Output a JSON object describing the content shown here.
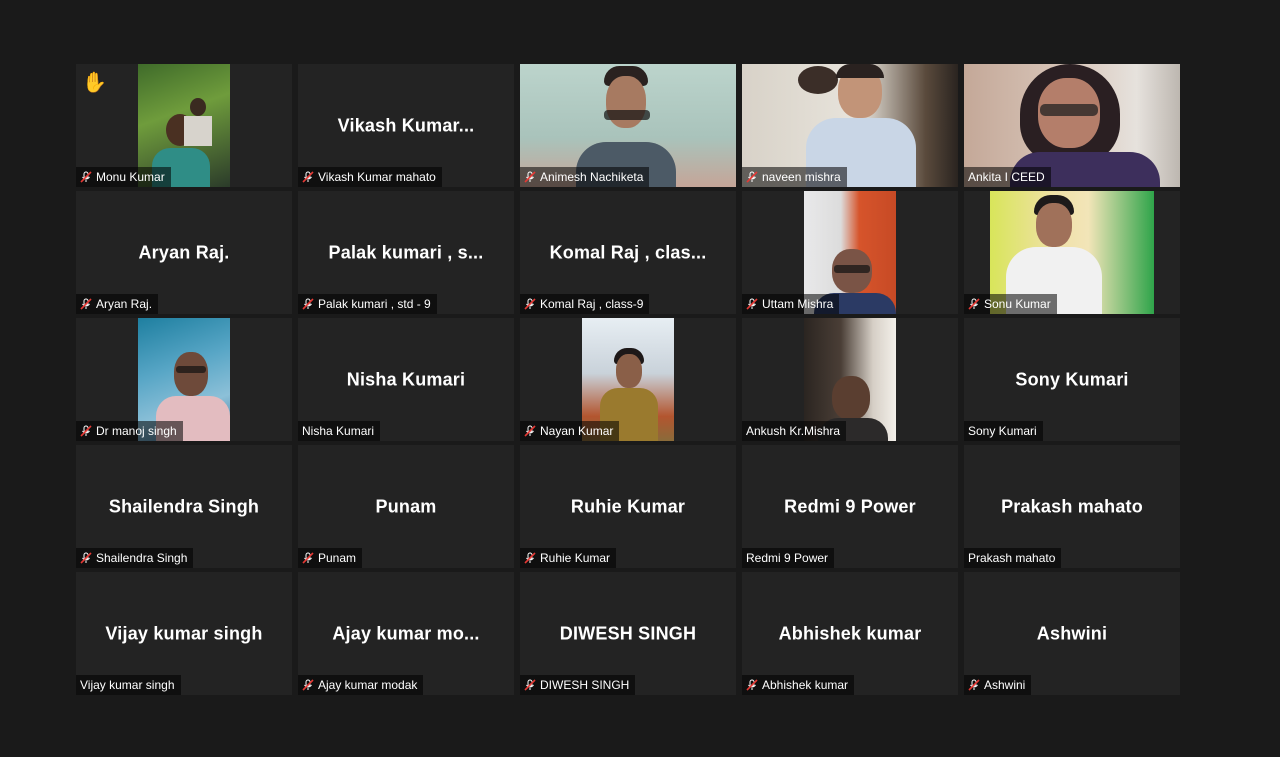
{
  "participants": [
    {
      "label": "Monu Kumar",
      "muted": true,
      "video": true,
      "hand": true
    },
    {
      "label": "Vikash Kumar mahato",
      "display": "Vikash  Kumar...",
      "muted": true,
      "video": false
    },
    {
      "label": "Animesh Nachiketa",
      "muted": true,
      "video": true
    },
    {
      "label": "naveen mishra",
      "muted": true,
      "video": true
    },
    {
      "label": "Ankita I CEED",
      "muted": false,
      "video": true,
      "active": true
    },
    {
      "label": "Aryan Raj.",
      "display": "Aryan Raj.",
      "muted": true,
      "video": false
    },
    {
      "label": "Palak kumari , std - 9",
      "display": "Palak kumari , s...",
      "muted": true,
      "video": false
    },
    {
      "label": "Komal Raj , class-9",
      "display": "Komal Raj , clas...",
      "muted": true,
      "video": false
    },
    {
      "label": "Uttam Mishra",
      "muted": true,
      "video": true
    },
    {
      "label": "Sonu Kumar",
      "muted": true,
      "video": true
    },
    {
      "label": "Dr manoj singh",
      "muted": true,
      "video": true
    },
    {
      "label": "Nisha Kumari",
      "display": "Nisha Kumari",
      "muted": false,
      "video": false
    },
    {
      "label": "Nayan Kumar",
      "muted": true,
      "video": true
    },
    {
      "label": "Ankush Kr.Mishra",
      "muted": false,
      "video": true
    },
    {
      "label": "Sony Kumari",
      "display": "Sony Kumari",
      "muted": false,
      "video": false
    },
    {
      "label": "Shailendra Singh",
      "display": "Shailendra Singh",
      "muted": true,
      "video": false
    },
    {
      "label": "Punam",
      "display": "Punam",
      "muted": true,
      "video": false
    },
    {
      "label": "Ruhie Kumar",
      "display": "Ruhie Kumar",
      "muted": true,
      "video": false
    },
    {
      "label": "Redmi 9 Power",
      "display": "Redmi 9 Power",
      "muted": false,
      "video": false
    },
    {
      "label": "Prakash mahato",
      "display": "Prakash mahato",
      "muted": false,
      "video": false
    },
    {
      "label": "Vijay kumar singh",
      "display": "Vijay kumar singh",
      "muted": false,
      "video": false
    },
    {
      "label": "Ajay kumar modak",
      "display": "Ajay  kumar  mo...",
      "muted": true,
      "video": false
    },
    {
      "label": "DIWESH SINGH",
      "display": "DIWESH SINGH",
      "muted": true,
      "video": false
    },
    {
      "label": "Abhishek kumar",
      "display": "Abhishek kumar",
      "muted": true,
      "video": false
    },
    {
      "label": "Ashwini",
      "display": "Ashwini",
      "muted": true,
      "video": false
    }
  ],
  "colors": {
    "background": "#1a1a1a",
    "tile": "#232323",
    "active_outline": "#e8e35a",
    "muted_icon": "#e53935"
  }
}
